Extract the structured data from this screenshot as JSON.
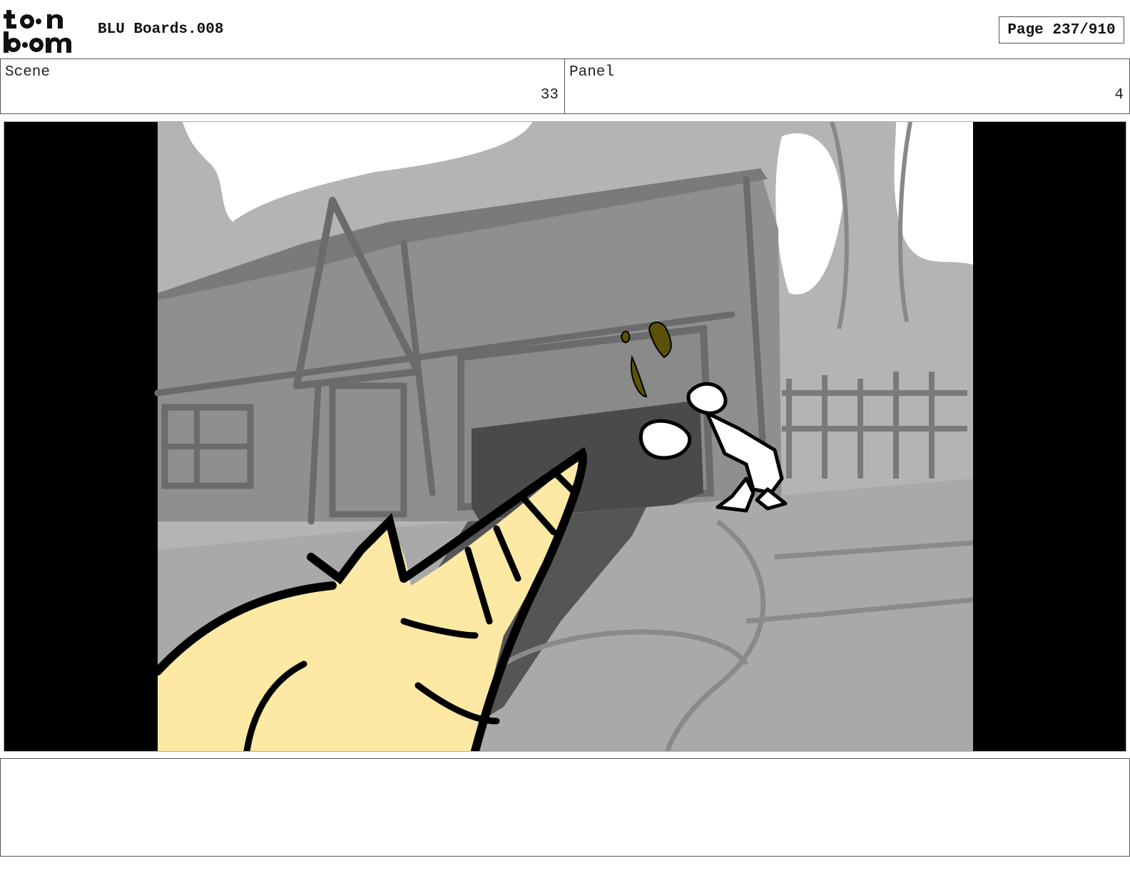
{
  "header": {
    "logo_text": "toonboom",
    "title": "BLU Boards.008",
    "page": "Page 237/910"
  },
  "scene": {
    "label": "Scene",
    "value": "33"
  },
  "panel": {
    "label": "Panel",
    "value": "4"
  },
  "artwork": {
    "colors": {
      "letterbox": "#000000",
      "sky": "#ffffff",
      "background": "#b4b4b4",
      "barn": "#8f8f8f",
      "barn_dark": "#7a7a7a",
      "garage_opening": "#4a4a4a",
      "road": "#a9a9a9",
      "creature_fill": "#fde9a3",
      "ink": "#000000",
      "splash": "#5a5208",
      "character_fill": "#ffffff"
    }
  },
  "notes": {
    "text": ""
  }
}
